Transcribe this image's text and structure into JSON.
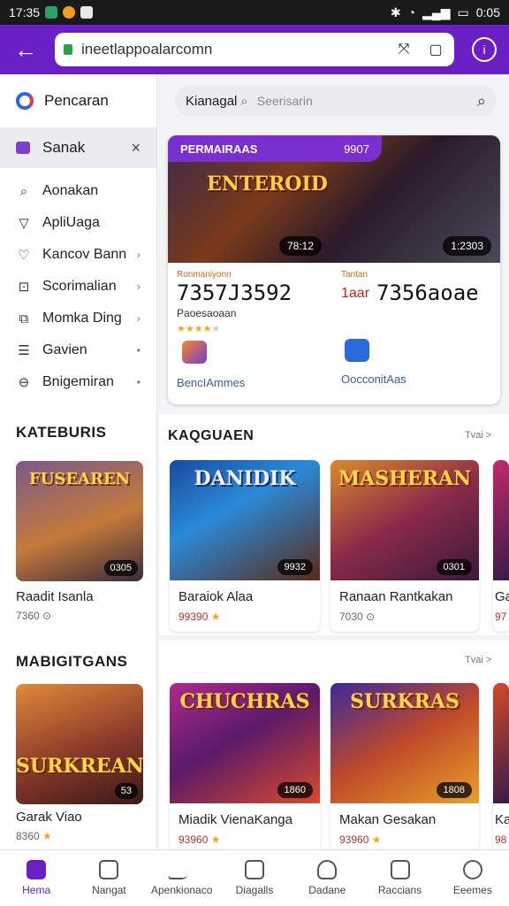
{
  "status_bar": {
    "time": "17:35",
    "battery": "0:05"
  },
  "browser": {
    "url": "ineetlappoalarcomn"
  },
  "colors": {
    "accent": "#6a1fc4",
    "rating_star": "#f3a81c"
  },
  "sidebar": {
    "search_label": "Pencaran",
    "selected": "Sanak",
    "items": [
      {
        "label": "Aonakan",
        "icon": "brush-icon"
      },
      {
        "label": "ApliUaga",
        "icon": "triangle-icon"
      },
      {
        "label": "Kancov Bann",
        "icon": "heart-icon"
      },
      {
        "label": "Scorimalian",
        "icon": "square-icon"
      },
      {
        "label": "Momka Ding",
        "icon": "copy-icon"
      },
      {
        "label": "Gavien",
        "icon": "list-icon"
      },
      {
        "label": "Bnigemiran",
        "icon": "shield-icon"
      }
    ],
    "sections": [
      {
        "heading": "KATEBURIS",
        "tile_logo": "FUSEAREN",
        "badge": "0305",
        "title": "Raadit Isanla",
        "meta": "7360 ⊙"
      },
      {
        "heading": "MABIGITGANS",
        "tile_logo": "SURKREAN",
        "badge": "53",
        "title": "Garak Viao",
        "meta": "8360"
      }
    ]
  },
  "main_search": {
    "value": "Kianagal",
    "placeholder": "Seerisarin"
  },
  "featured": {
    "pill_label": "PERMAIRAAS",
    "pill_value": "9907",
    "art_logo": "ENTEROID",
    "badge_left": "78:12",
    "badge_right": "1:2303",
    "stat1_label": "Ronmaniyonn",
    "stat1_value": "7357J3592",
    "stat1_sub": "Paoesaoaan",
    "stat2_label": "Tantan",
    "stat2_prefix": "1aar",
    "stat2_value": "7356aoae",
    "rating": 4,
    "link1": "BencIAmmes",
    "link2": "OocconitAas"
  },
  "sections": [
    {
      "heading": "KAQGUAEN",
      "more": "Tvai >",
      "cards": [
        {
          "logo": "DANIDIK",
          "badge": "9932",
          "title": "Baraiok Alaa",
          "meta": "99390"
        },
        {
          "logo": "MASHERAN",
          "badge": "0301",
          "title": "Ranaan Rantkakan",
          "meta": "7030 ⊙"
        },
        {
          "logo": "",
          "badge": "",
          "title": "Ga",
          "meta": "97"
        }
      ]
    },
    {
      "heading": "",
      "more": "Tvai >",
      "cards": [
        {
          "logo": "CHUCHRAS",
          "badge": "1860",
          "title": "Miadik VienaKanga",
          "meta": "93960"
        },
        {
          "logo": "SURKRAS",
          "badge": "1808",
          "title": "Makan Gesakan",
          "meta": "93960"
        },
        {
          "logo": "",
          "badge": "",
          "title": "Ka",
          "meta": "98"
        }
      ]
    }
  ],
  "bottom_nav": [
    {
      "label": "Hema",
      "icon": "home-icon",
      "active": true
    },
    {
      "label": "Nangat",
      "icon": "grid-icon",
      "active": false
    },
    {
      "label": "Apenkionaco",
      "icon": "arrow-icon",
      "active": false
    },
    {
      "label": "Diagalls",
      "icon": "doc-icon",
      "active": false
    },
    {
      "label": "Dadane",
      "icon": "heart-icon",
      "active": false
    },
    {
      "label": "Raccians",
      "icon": "clock-icon",
      "active": false
    },
    {
      "label": "Eeemes",
      "icon": "person-icon",
      "active": false
    }
  ]
}
